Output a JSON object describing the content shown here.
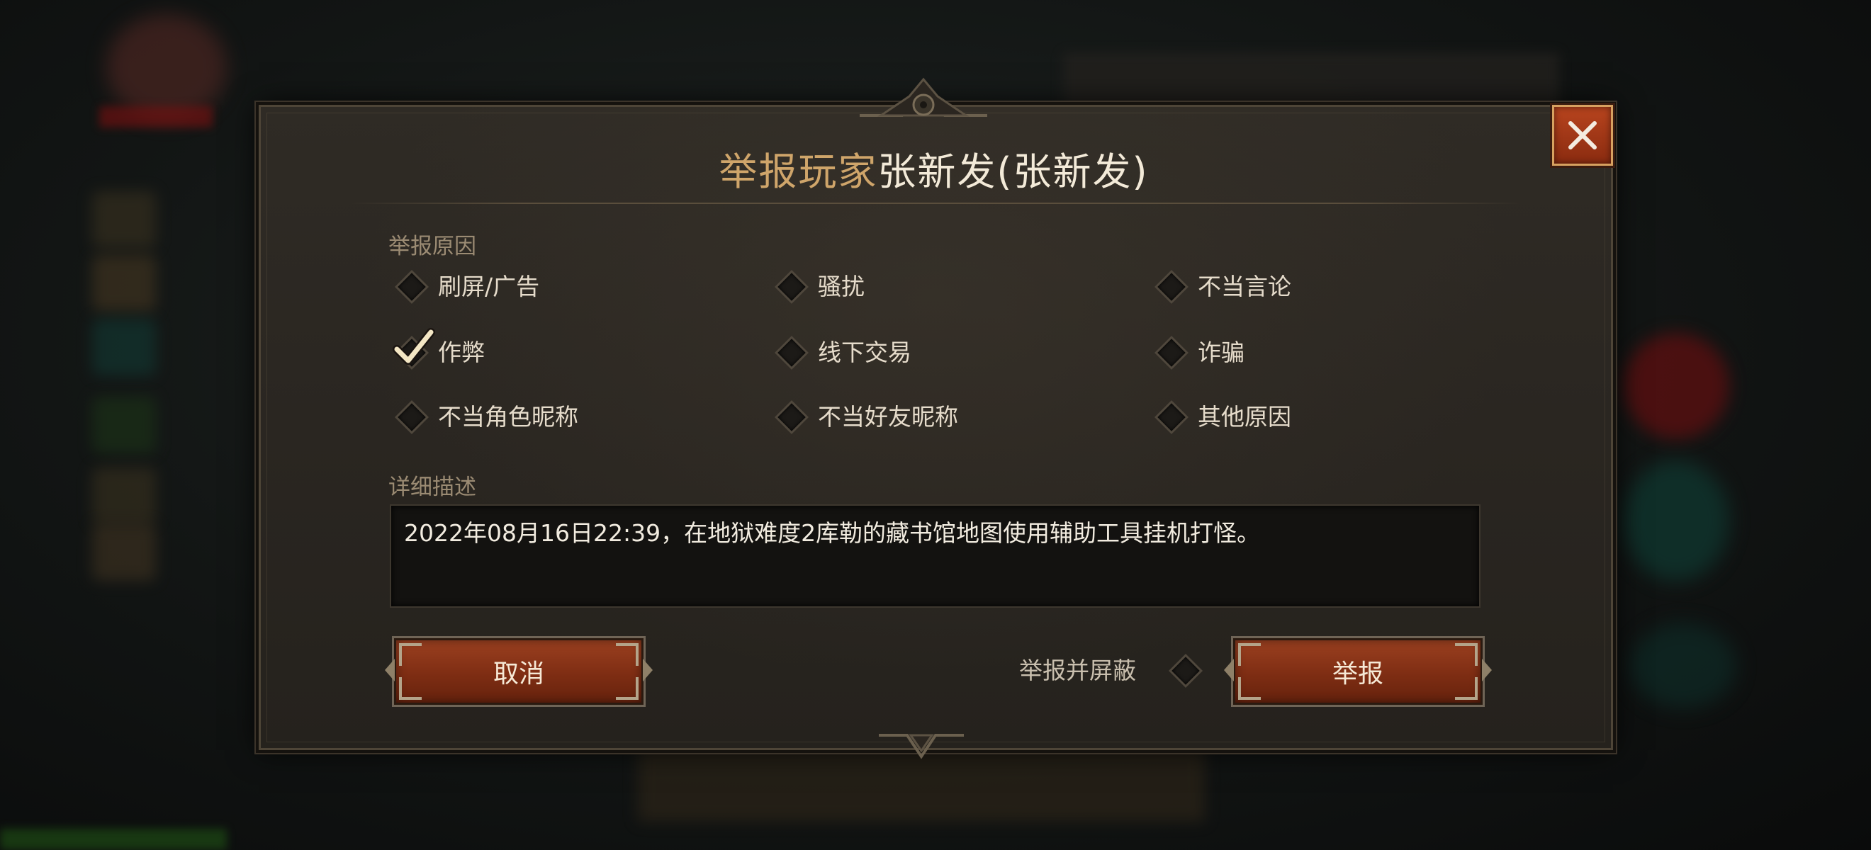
{
  "dialog": {
    "title_prefix": "举报玩家",
    "title_player": "张新发(张新发)",
    "close_icon": "close-x-icon"
  },
  "reasons": {
    "label": "举报原因",
    "options": [
      {
        "label": "刷屏/广告",
        "checked": false
      },
      {
        "label": "骚扰",
        "checked": false
      },
      {
        "label": "不当言论",
        "checked": false
      },
      {
        "label": "作弊",
        "checked": true
      },
      {
        "label": "线下交易",
        "checked": false
      },
      {
        "label": "诈骗",
        "checked": false
      },
      {
        "label": "不当角色昵称",
        "checked": false
      },
      {
        "label": "不当好友昵称",
        "checked": false
      },
      {
        "label": "其他原因",
        "checked": false
      }
    ]
  },
  "description": {
    "label": "详细描述",
    "value": "2022年08月16日22:39，在地狱难度2库勒的藏书馆地图使用辅助工具挂机打怪。"
  },
  "actions": {
    "cancel_label": "取消",
    "report_and_block_label": "举报并屏蔽",
    "report_and_block_checked": false,
    "report_label": "举报"
  },
  "colors": {
    "accent_gold": "#cfa56a",
    "button_red": "#9b4020",
    "check_color": "#f3e6c4"
  }
}
